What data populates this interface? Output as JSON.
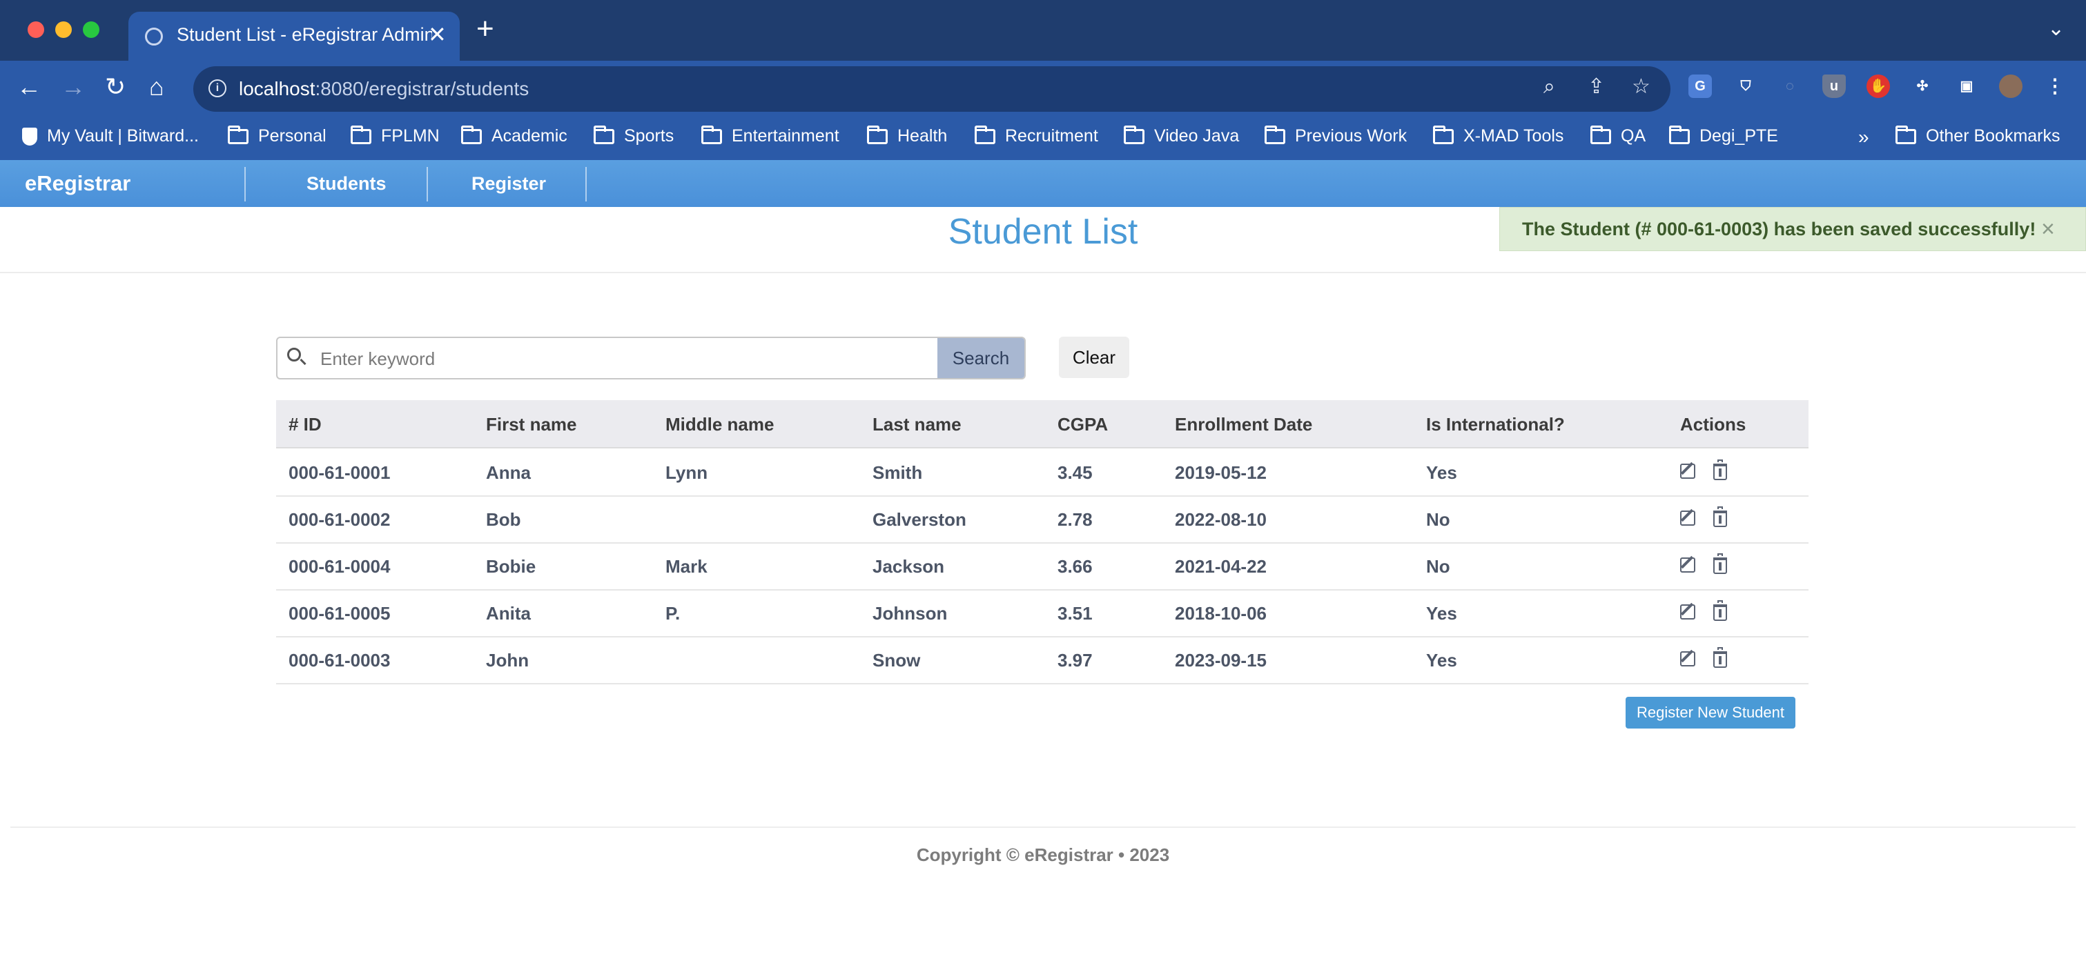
{
  "browser": {
    "tab_title": "Student List - eRegistrar Admin",
    "tab_close": "✕",
    "new_tab": "+",
    "url_host": "localhost",
    "url_path": ":8080/eregistrar/students",
    "bookmarks": [
      {
        "label": "My Vault | Bitward...",
        "icon": "bitwarden-shield-icon"
      },
      {
        "label": "Personal",
        "icon": "folder-icon"
      },
      {
        "label": "FPLMN",
        "icon": "folder-icon"
      },
      {
        "label": "Academic",
        "icon": "folder-icon"
      },
      {
        "label": "Sports",
        "icon": "folder-icon"
      },
      {
        "label": "Entertainment",
        "icon": "folder-icon"
      },
      {
        "label": "Health",
        "icon": "folder-icon"
      },
      {
        "label": "Recruitment",
        "icon": "folder-icon"
      },
      {
        "label": "Video Java",
        "icon": "folder-icon"
      },
      {
        "label": "Previous Work",
        "icon": "folder-icon"
      },
      {
        "label": "X-MAD Tools",
        "icon": "folder-icon"
      },
      {
        "label": "QA",
        "icon": "folder-icon"
      },
      {
        "label": "Degi_PTE",
        "icon": "folder-icon"
      }
    ],
    "overflow": "»",
    "other_bookmarks": "Other Bookmarks"
  },
  "app": {
    "brand": "eRegistrar",
    "nav": [
      {
        "label": "Students"
      },
      {
        "label": "Register"
      }
    ]
  },
  "page": {
    "title": "Student List",
    "alert": {
      "message": "The Student (# 000-61-0003) has been saved successfully!",
      "close": "×"
    },
    "search": {
      "placeholder": "Enter keyword",
      "button": "Search",
      "clear": "Clear"
    },
    "table": {
      "headers": [
        "# ID",
        "First name",
        "Middle name",
        "Last name",
        "CGPA",
        "Enrollment Date",
        "Is International?",
        "Actions"
      ],
      "rows": [
        {
          "id": "000-61-0001",
          "first": "Anna",
          "middle": "Lynn",
          "last": "Smith",
          "cgpa": "3.45",
          "date": "2019-05-12",
          "intl": "Yes"
        },
        {
          "id": "000-61-0002",
          "first": "Bob",
          "middle": "",
          "last": "Galverston",
          "cgpa": "2.78",
          "date": "2022-08-10",
          "intl": "No"
        },
        {
          "id": "000-61-0004",
          "first": "Bobie",
          "middle": "Mark",
          "last": "Jackson",
          "cgpa": "3.66",
          "date": "2021-04-22",
          "intl": "No"
        },
        {
          "id": "000-61-0005",
          "first": "Anita",
          "middle": "P.",
          "last": "Johnson",
          "cgpa": "3.51",
          "date": "2018-10-06",
          "intl": "Yes"
        },
        {
          "id": "000-61-0003",
          "first": "John",
          "middle": "",
          "last": "Snow",
          "cgpa": "3.97",
          "date": "2023-09-15",
          "intl": "Yes"
        }
      ]
    },
    "register_button": "Register New Student",
    "footer": "Copyright © eRegistrar • 2023"
  },
  "colors": {
    "tab_strip": "#1f3d6e",
    "toolbar": "#2b5aa8",
    "app_bar": "#4a90d9",
    "title": "#4a9ad6",
    "alert_bg": "#dfedd6",
    "alert_text": "#3c5a2b",
    "search_button": "#a8b7d1"
  }
}
